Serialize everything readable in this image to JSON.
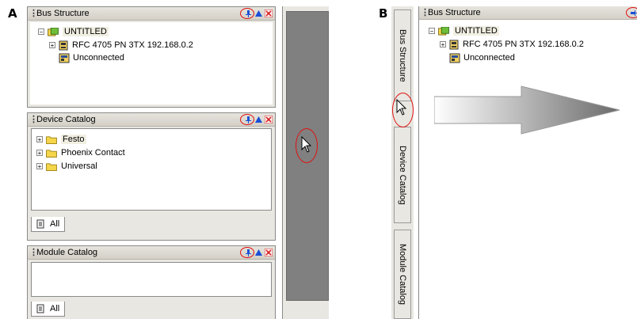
{
  "labels": {
    "A": "A",
    "B": "B"
  },
  "panel_a": {
    "bus_structure": {
      "title": "Bus Structure",
      "tree": {
        "root": "UNTITLED",
        "device": "RFC 4705 PN 3TX 192.168.0.2",
        "unconnected": "Unconnected"
      }
    },
    "device_catalog": {
      "title": "Device Catalog",
      "items": [
        "Festo",
        "Phoenix Contact",
        "Universal"
      ],
      "tab_label": "All"
    },
    "module_catalog": {
      "title": "Module Catalog",
      "tab_label": "All"
    }
  },
  "panel_b": {
    "side_tabs": [
      "Bus Structure",
      "Device Catalog",
      "Module Catalog"
    ],
    "bus_structure": {
      "title": "Bus Structure",
      "tree": {
        "root": "UNTITLED",
        "device": "RFC 4705 PN 3TX 192.168.0.2",
        "unconnected": "Unconnected"
      }
    }
  },
  "colors": {
    "highlight_circle": "#e01010",
    "pin_blue": "#1a4fd6",
    "close_red": "#d62020",
    "folder_yellow": "#f5d54a",
    "hidden_bar_gray": "#808080"
  },
  "icons": [
    "grip-icon",
    "pin-icon",
    "maximize-icon",
    "close-icon",
    "folder-icon",
    "project-icon",
    "device-icon",
    "unconnected-icon",
    "cursor-icon",
    "arrow-icon",
    "tab-all-icon"
  ]
}
